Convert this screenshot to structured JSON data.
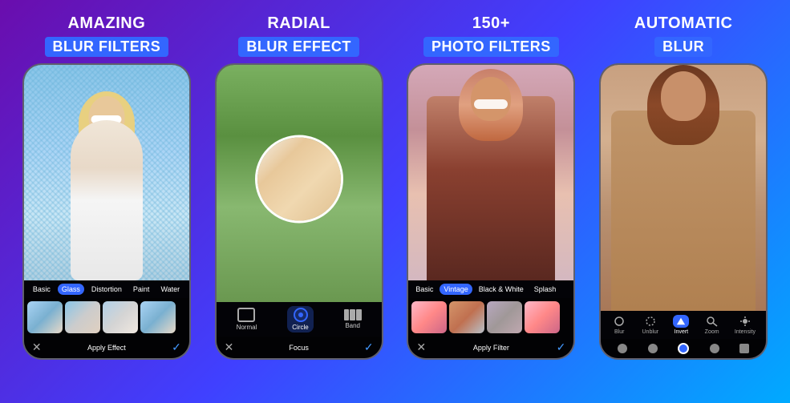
{
  "panels": [
    {
      "id": "panel1",
      "title_line1": "AMAZING",
      "title_line2": "BLUR FILTERS",
      "filter_tabs": [
        "Basic",
        "Glass",
        "Distortion",
        "Paint",
        "Water"
      ],
      "active_tab": "Glass",
      "apply_label": "Apply Effect"
    },
    {
      "id": "panel2",
      "title_line1": "RADIAL",
      "title_line2": "BLUR EFFECT",
      "focus_items": [
        "Normal",
        "Circle",
        "Band"
      ],
      "active_focus": "Circle",
      "focus_label": "Focus"
    },
    {
      "id": "panel3",
      "title_line1": "150+",
      "title_line2": "PHOTO FILTERS",
      "filter_tabs": [
        "Basic",
        "Vintage",
        "Black & White",
        "Splash"
      ],
      "active_tab": "Vintage",
      "apply_label": "Apply Filter"
    },
    {
      "id": "panel4",
      "title_line1": "AUTOMATIC",
      "title_line2": "BLUR",
      "tools": [
        "Blur",
        "Unblur",
        "Invert",
        "Zoom",
        "Intensity"
      ],
      "active_tool": "Invert"
    }
  ]
}
